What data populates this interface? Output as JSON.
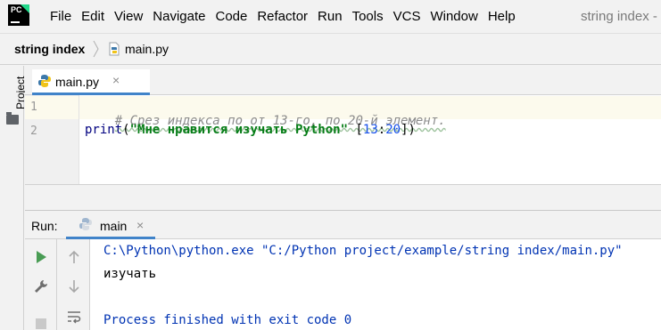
{
  "menubar": {
    "logo_text": "PC",
    "items": [
      "File",
      "Edit",
      "View",
      "Navigate",
      "Code",
      "Refactor",
      "Run",
      "Tools",
      "VCS",
      "Window",
      "Help"
    ],
    "window_title": "string index -"
  },
  "breadcrumb": {
    "project": "string index",
    "file": "main.py"
  },
  "left_strip": {
    "project_label": "Project",
    "icons": [
      "folder-icon"
    ]
  },
  "editor": {
    "tab": {
      "label": "main.py",
      "close": "×",
      "icon": "python-file-icon"
    },
    "lines": [
      {
        "number": "1",
        "comment": "# Срез индекса по от 13-го, по 20-й элемент."
      },
      {
        "number": "2",
        "fn": "print",
        "open_paren": "(",
        "string": "\"Мне нравится изучать Python\"",
        "space": " ",
        "bracket_open": "[",
        "start": "13",
        "colon": ":",
        "end": "20",
        "bracket_close": "]",
        "close_paren": ")"
      }
    ]
  },
  "run_panel": {
    "label": "Run:",
    "tab": {
      "label": "main",
      "close": "×",
      "icon": "python-run-icon"
    },
    "toolbar_icons": [
      "play-icon",
      "wrench-icon",
      "stop-icon",
      "arrow-up-icon",
      "arrow-down-icon",
      "soft-wrap-icon"
    ],
    "console": {
      "command": "C:\\Python\\python.exe \"C:/Python project/example/string index/main.py\"",
      "output": "изучать",
      "exit": "Process finished with exit code 0"
    }
  },
  "colors": {
    "accent": "#4083c9",
    "string": "#067d17",
    "number": "#1750eb",
    "comment": "#8c8c8c",
    "console_blue": "#0033b3",
    "run_green": "#499c54"
  }
}
